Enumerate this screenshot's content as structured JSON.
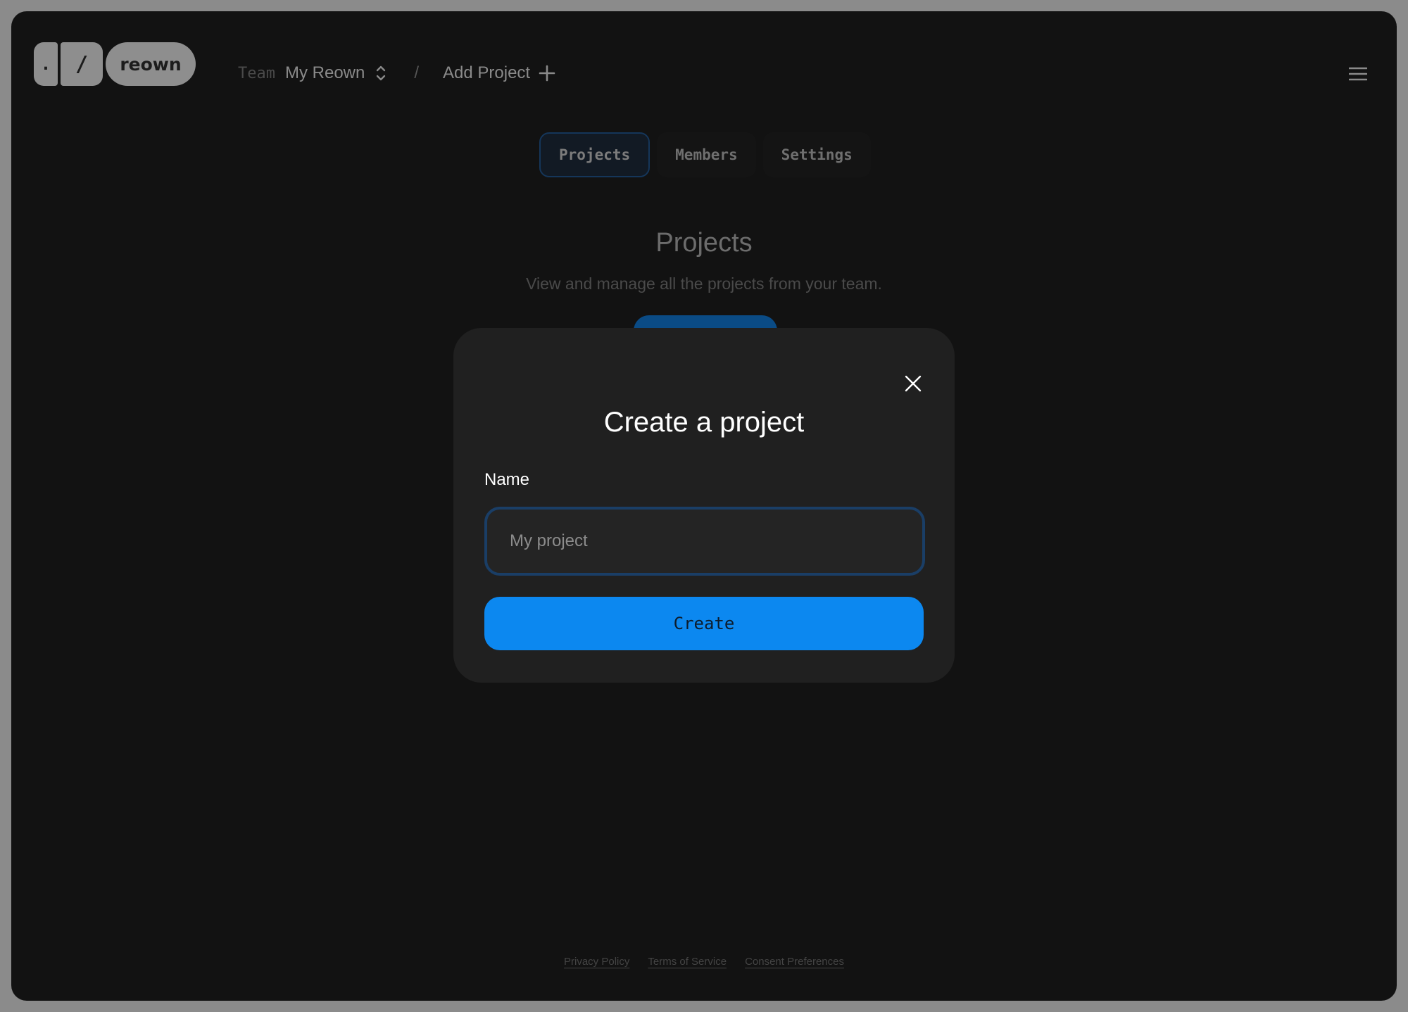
{
  "logo": {
    "dot": ".",
    "slash": "/",
    "word": "reown"
  },
  "header": {
    "team_label": "Team",
    "team_name": "My Reown",
    "separator": "/",
    "add_project": "Add Project"
  },
  "tabs": [
    {
      "label": "Projects",
      "active": true
    },
    {
      "label": "Members",
      "active": false
    },
    {
      "label": "Settings",
      "active": false
    }
  ],
  "page": {
    "title": "Projects",
    "subtitle": "View and manage all the projects from your team."
  },
  "footer": {
    "links": [
      "Privacy Policy",
      "Terms of Service",
      "Consent Preferences"
    ]
  },
  "modal": {
    "title": "Create a project",
    "name_label": "Name",
    "name_placeholder": "My project",
    "name_value": "",
    "create_label": "Create"
  },
  "colors": {
    "accent": "#0c88f0",
    "modal_bg": "#202020",
    "page_bg": "#121212"
  },
  "icons": {
    "team_switch": "chevron-up-down-icon",
    "add": "plus-icon",
    "menu": "hamburger-menu-icon",
    "close": "close-icon"
  }
}
